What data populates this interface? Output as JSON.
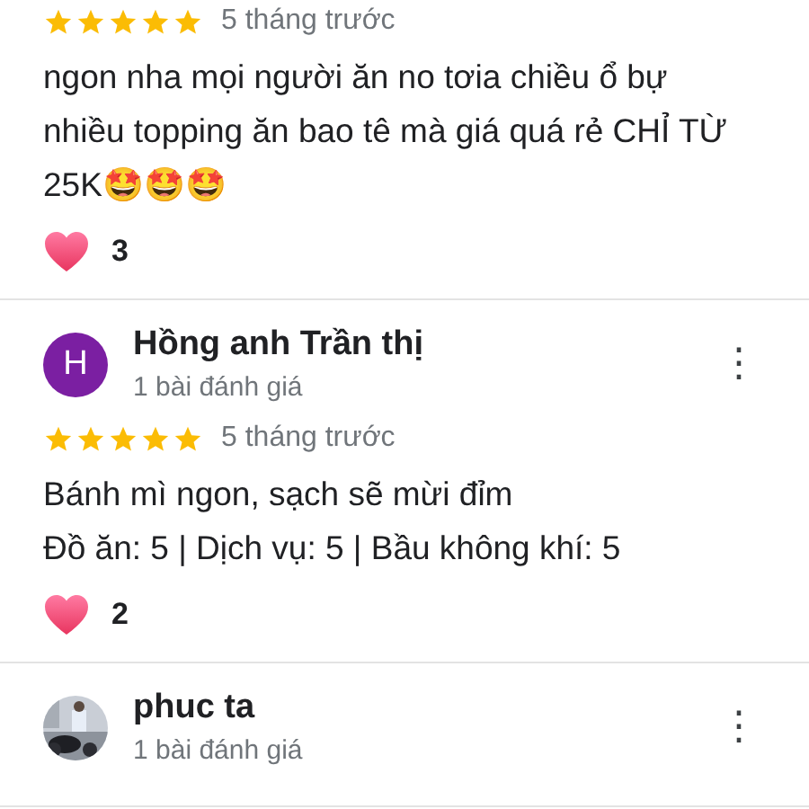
{
  "reviews": [
    {
      "stars": 5,
      "time": "5 tháng trước",
      "text_lines": [
        "ngon nha mọi người ăn no tơia chiều ổ bự",
        "nhiều topping ăn bao tê mà giá quá rẻ CHỈ TỪ",
        "25K🤩🤩🤩"
      ],
      "likes": "3"
    },
    {
      "author": {
        "name": "Hồng anh Trần thị",
        "avatar": {
          "kind": "letter",
          "letter": "H",
          "color": "#7b1fa2"
        },
        "review_count": "1 bài đánh giá",
        "menu": "⋮"
      },
      "stars": 5,
      "time": "5 tháng trước",
      "text_lines": [
        "Bánh mì ngon, sạch sẽ mừi đỉm",
        "Đồ ăn: 5 | Dịch vụ: 5 | Bầu không khí: 5"
      ],
      "likes": "2"
    },
    {
      "author": {
        "name": "phuc ta",
        "review_count": "1 bài đánh giá",
        "menu": "⋮"
      }
    }
  ]
}
